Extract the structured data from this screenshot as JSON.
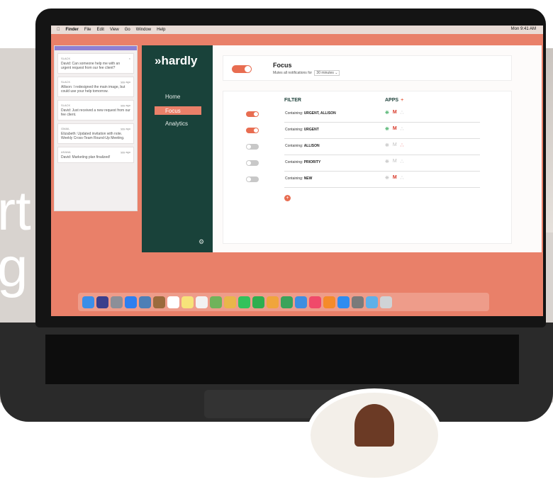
{
  "background_text": [
    "rt",
    "g"
  ],
  "menubar": {
    "items": [
      "Finder",
      "File",
      "Edit",
      "View",
      "Go",
      "Window",
      "Help"
    ],
    "clock": "Mon 9:41 AM"
  },
  "slack_panel": {
    "notifications": [
      {
        "source": "SLACK",
        "time": "",
        "text": "David: Can someone help me with an urgent request from our fee client?"
      },
      {
        "source": "SLACK",
        "time": "yyy ago",
        "text": "Allison: I redesigned the main image, but could use your help tomorrow."
      },
      {
        "source": "SLACK",
        "time": "yyy ago",
        "text": "David: Just received a new request from our fee client."
      },
      {
        "source": "GMAIL",
        "time": "yyy ago",
        "text": "Elizabeth: Updated invitation with note. Weekly Cross-Team Round-Up Meeting."
      },
      {
        "source": "ASANA",
        "time": "yyy ago",
        "text": "David: Marketing plan finalized!"
      }
    ]
  },
  "app": {
    "logo": "»hardly",
    "nav": [
      {
        "label": "Home",
        "active": false
      },
      {
        "label": "Focus",
        "active": true
      },
      {
        "label": "Analytics",
        "active": false
      }
    ],
    "focus": {
      "title": "Focus",
      "subtitle": "Mutes all notifications for",
      "duration": "30 minutes",
      "enabled": true
    },
    "filter_header": "FILTER",
    "apps_header": "APPS",
    "apps_add": "+",
    "filters": [
      {
        "prefix": "Containing:",
        "value": "URGENT, ALLISON",
        "enabled": true,
        "apps": [
          "slack-on",
          "gmail-on",
          "asana-off"
        ]
      },
      {
        "prefix": "Containing:",
        "value": "URGENT",
        "enabled": true,
        "apps": [
          "slack-on",
          "gmail-on",
          "asana-off"
        ]
      },
      {
        "prefix": "Containing:",
        "value": "ALLISON",
        "enabled": false,
        "apps": [
          "slack-off",
          "gmail-off",
          "asana-on"
        ]
      },
      {
        "prefix": "Containing:",
        "value": "PRIORITY",
        "enabled": false,
        "apps": [
          "slack-off",
          "gmail-off",
          "asana-off"
        ]
      },
      {
        "prefix": "Containing:",
        "value": "NEW",
        "enabled": false,
        "apps": [
          "slack-off",
          "gmail-on",
          "asana-off"
        ]
      }
    ]
  },
  "colors": {
    "accent": "#e86d51",
    "sidebar": "#19423a",
    "desktop": "#e98069"
  },
  "dock_icons": [
    "finder-icon",
    "siri-icon",
    "launchpad-icon",
    "safari-icon",
    "photos-icon",
    "contacts-icon",
    "calendar-icon",
    "notes-icon",
    "reminders-icon",
    "maps-icon",
    "photos-app-icon",
    "messages-icon",
    "facetime-icon",
    "pages-icon",
    "numbers-icon",
    "keynote-icon",
    "music-icon",
    "books-icon",
    "appstore-icon",
    "preferences-icon",
    "downloads-icon",
    "trash-icon"
  ]
}
